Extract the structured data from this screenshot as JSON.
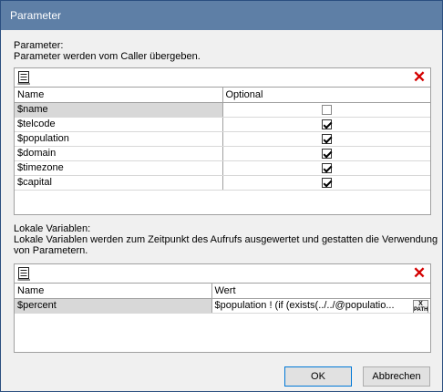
{
  "window": {
    "title": "Parameter"
  },
  "params_section": {
    "label": "Parameter:",
    "description": "Parameter werden vom Caller übergeben.",
    "columns": [
      "Name",
      "Optional"
    ],
    "rows": [
      {
        "name": "$name",
        "optional": false
      },
      {
        "name": "$telcode",
        "optional": true
      },
      {
        "name": "$population",
        "optional": true
      },
      {
        "name": "$domain",
        "optional": true
      },
      {
        "name": "$timezone",
        "optional": true
      },
      {
        "name": "$capital",
        "optional": true
      }
    ]
  },
  "vars_section": {
    "label": "Lokale Variablen:",
    "description_line1": "Lokale Variablen werden zum Zeitpunkt des Aufrufs ausgewertet und gestatten die Verwendung",
    "description_line2": "von Parametern.",
    "columns": [
      "Name",
      "Wert"
    ],
    "rows": [
      {
        "name": "$percent",
        "value": "$population ! (if (exists(../../@populatio..."
      }
    ],
    "xpath_label_top": "X",
    "xpath_label_bottom": "PATH"
  },
  "buttons": {
    "ok": "OK",
    "cancel": "Abbrechen"
  },
  "icons": {
    "add": "add-row-icon",
    "delete": "delete-icon"
  }
}
